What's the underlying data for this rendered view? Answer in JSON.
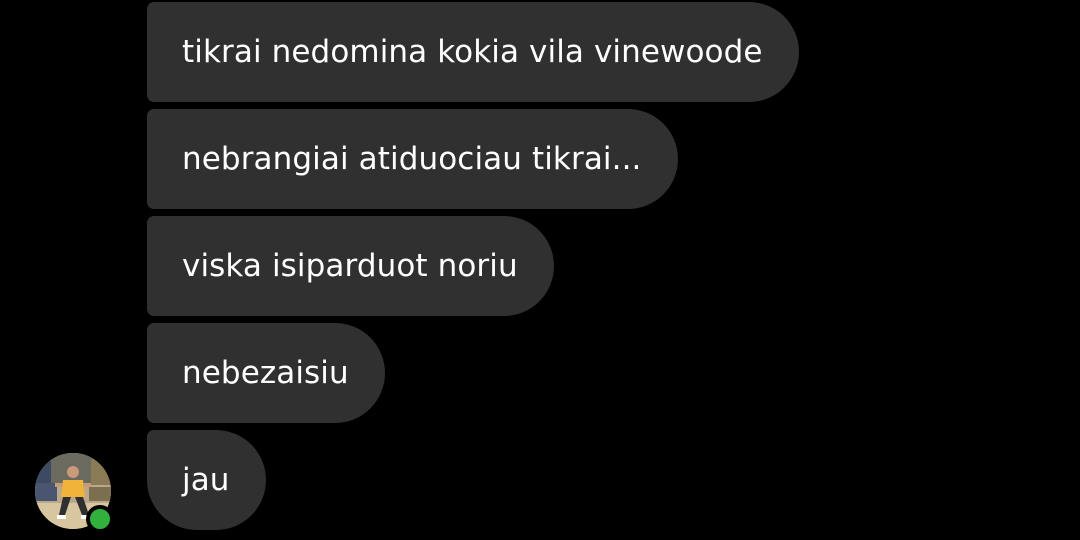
{
  "messages": [
    {
      "text": "tikrai nedomina kokia vila vinewoode"
    },
    {
      "text": "nebrangiai atiduociau tikrai..."
    },
    {
      "text": "viska isiparduot noriu"
    },
    {
      "text": "nebezaisiu"
    },
    {
      "text": "jau"
    }
  ],
  "contact": {
    "online": true,
    "presence_color": "#31b03c"
  },
  "colors": {
    "background": "#000000",
    "bubble": "#303030",
    "text": "#ffffff"
  }
}
